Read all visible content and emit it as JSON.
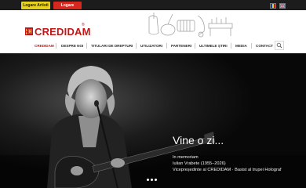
{
  "topbar": {
    "login_artist_label": "Logare Artisti",
    "login_user_label": "Logare utilizatori",
    "lang_ro": "Română",
    "lang_en": "English"
  },
  "header": {
    "logo_text": "CREDIDAM",
    "logo_reg": "®"
  },
  "nav": {
    "items": [
      {
        "label": "CREDIDAM",
        "active": true
      },
      {
        "label": "DESPRE NOI",
        "active": false
      },
      {
        "label": "TITULARI DE DREPTURI",
        "active": false
      },
      {
        "label": "UTILIZATORI",
        "active": false
      },
      {
        "label": "PARTENERI",
        "active": false
      },
      {
        "label": "ULTIMELE ȘTIRI",
        "active": false
      },
      {
        "label": "MEDIA",
        "active": false
      },
      {
        "label": "CONTACT",
        "active": false
      }
    ]
  },
  "hero": {
    "title": "Vine o zi...",
    "line1": "In memoriam",
    "line2": "Iulian Vrabete (1955–2026)",
    "line3": "Vicepreședinte al CREDIDAM · Basist al trupei Holograf"
  },
  "carousel": {
    "slide_count": 3,
    "active_index": 0
  },
  "colors": {
    "brand_red": "#c01616",
    "login_artist_bg": "#e7d21f",
    "login_user_bg": "#d7281f",
    "topbar_bg": "#1c1c1c",
    "hero_bg": "#0c0c0c"
  },
  "icons": {
    "logo": "credidam-logo-icon",
    "search": "search-icon",
    "flag_ro": "flag-ro-icon",
    "flag_en": "flag-uk-icon"
  }
}
